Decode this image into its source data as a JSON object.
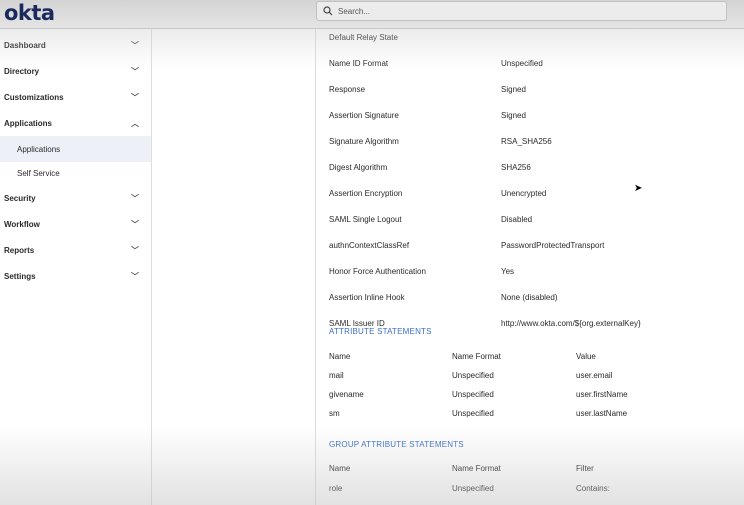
{
  "header": {
    "logo": "okta",
    "search_placeholder": "Search..."
  },
  "sidebar": {
    "items": [
      {
        "label": "Dashboard",
        "expanded": false
      },
      {
        "label": "Directory",
        "expanded": false
      },
      {
        "label": "Customizations",
        "expanded": false
      },
      {
        "label": "Applications",
        "expanded": true
      },
      {
        "label": "Applications",
        "sub": true,
        "active": true
      },
      {
        "label": "Self Service",
        "sub": true
      },
      {
        "label": "Security",
        "expanded": false
      },
      {
        "label": "Workflow",
        "expanded": false
      },
      {
        "label": "Reports",
        "expanded": false
      },
      {
        "label": "Settings",
        "expanded": false
      }
    ]
  },
  "settings": [
    {
      "label": "Default Relay State",
      "value": ""
    },
    {
      "label": "Name ID Format",
      "value": "Unspecified"
    },
    {
      "label": "Response",
      "value": "Signed"
    },
    {
      "label": "Assertion Signature",
      "value": "Signed"
    },
    {
      "label": "Signature Algorithm",
      "value": "RSA_SHA256"
    },
    {
      "label": "Digest Algorithm",
      "value": "SHA256"
    },
    {
      "label": "Assertion Encryption",
      "value": "Unencrypted"
    },
    {
      "label": "SAML Single Logout",
      "value": "Disabled"
    },
    {
      "label": "authnContextClassRef",
      "value": "PasswordProtectedTransport"
    },
    {
      "label": "Honor Force Authentication",
      "value": "Yes"
    },
    {
      "label": "Assertion Inline Hook",
      "value": "None (disabled)"
    },
    {
      "label": "SAML Issuer ID",
      "value": "http://www.okta.com/${org.externalKey}"
    }
  ],
  "attributes": {
    "title": "ATTRIBUTE STATEMENTS",
    "headers": [
      "Name",
      "Name Format",
      "Value"
    ],
    "rows": [
      [
        "mail",
        "Unspecified",
        "user.email"
      ],
      [
        "givename",
        "Unspecified",
        "user.firstName"
      ],
      [
        "sm",
        "Unspecified",
        "user.lastName"
      ]
    ]
  },
  "groups": {
    "title": "GROUP ATTRIBUTE STATEMENTS",
    "headers": [
      "Name",
      "Name Format",
      "Filter"
    ],
    "rows": [
      [
        "role",
        "Unspecified",
        "Contains:"
      ]
    ]
  },
  "colors": {
    "accent": "#3b6fc6",
    "logo": "#1a2a5c"
  }
}
